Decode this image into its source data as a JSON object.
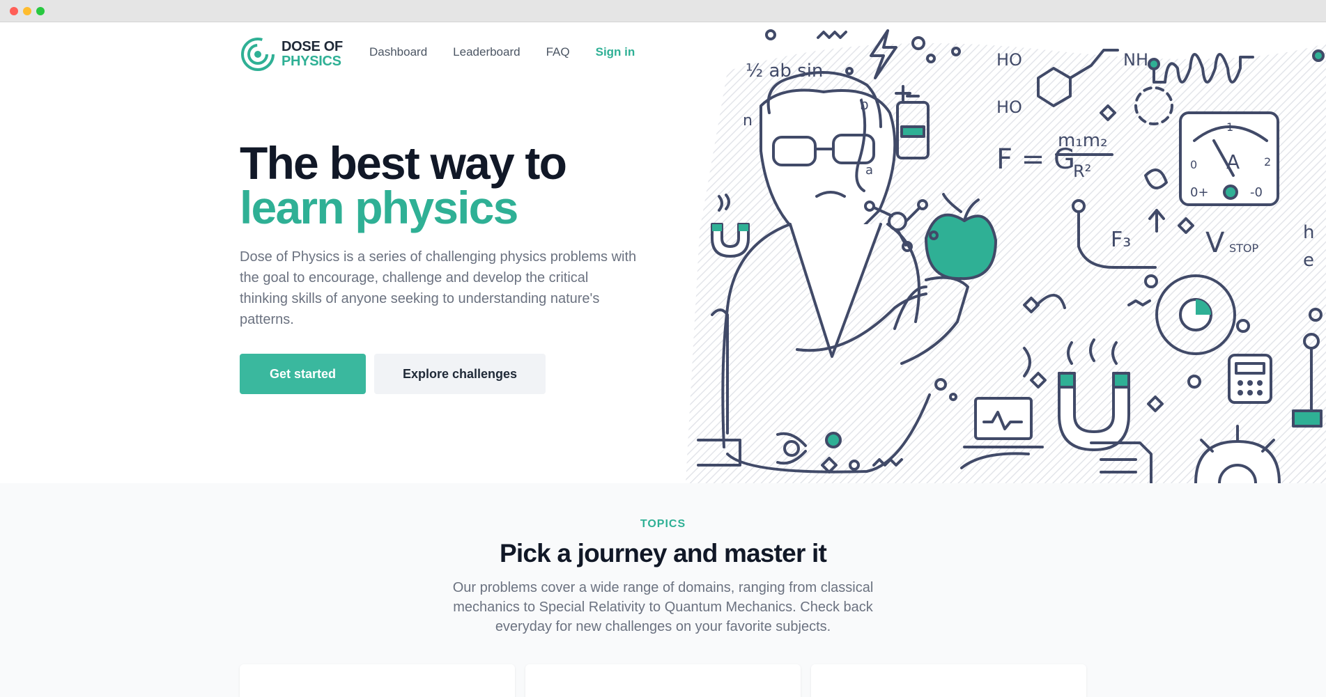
{
  "brand": {
    "line1": "DOSE OF",
    "line2": "PHYSICS",
    "accent_color": "#2fb095"
  },
  "nav": {
    "items": [
      {
        "label": "Dashboard"
      },
      {
        "label": "Leaderboard"
      },
      {
        "label": "FAQ"
      }
    ],
    "sign_in": "Sign in"
  },
  "hero": {
    "headline_line1": "The best way to",
    "headline_line2": "learn physics",
    "description": "Dose of Physics is a series of challenging physics problems with the goal to encourage, challenge and develop the critical thinking skills of anyone seeking to understanding nature's patterns.",
    "primary_button": "Get started",
    "secondary_button": "Explore challenges"
  },
  "illustration": {
    "formula_1": "½ ab sin",
    "formula_2": "F = G",
    "formula_2_num": "m₁m₂",
    "formula_2_den": "R²",
    "label_ho1": "HO",
    "label_ho2": "HO",
    "label_nh": "NH",
    "label_f3": "F₃",
    "label_vstop": "V",
    "label_vstop_sub": "STOP",
    "label_h": "h",
    "label_e": "e",
    "label_a": "A",
    "label_b": "b",
    "label_a_lower": "a",
    "label_n": "n",
    "meter_left": "0",
    "meter_one": "1",
    "meter_two": "2",
    "meter_plus": "0+",
    "meter_minus": "-0"
  },
  "topics": {
    "eyebrow": "TOPICS",
    "title": "Pick a journey and master it",
    "description": "Our problems cover a wide range of domains, ranging from classical mechanics to Special Relativity to Quantum Mechanics. Check back everyday for new challenges on your favorite subjects."
  }
}
